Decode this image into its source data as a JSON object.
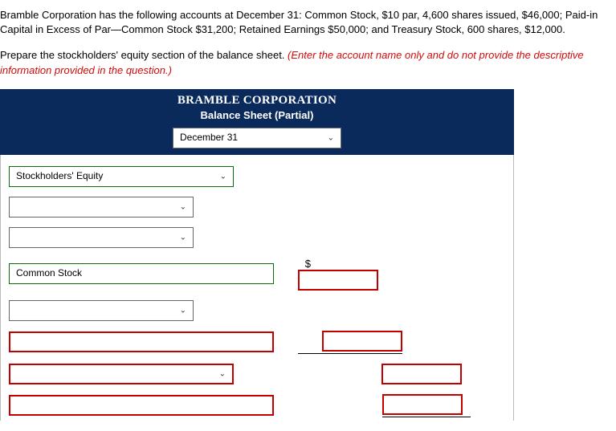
{
  "problem_text": "Bramble Corporation has the following accounts at December 31: Common Stock, $10 par, 4,600 shares issued, $46,000; Paid-in Capital in Excess of Par—Common Stock $31,200; Retained Earnings $50,000; and Treasury Stock, 600 shares, $12,000.",
  "instruction_plain": "Prepare the stockholders' equity section of the balance sheet. ",
  "instruction_red": "(Enter the account name only and do not provide the descriptive information provided in the question.)",
  "header": {
    "company": "BRAMBLE CORPORATION",
    "report": "Balance Sheet (Partial)",
    "date": "December 31"
  },
  "rows": {
    "r1_select": "Stockholders' Equity",
    "r2_select": "",
    "r3_select": "",
    "r4_text": "Common Stock",
    "r4_dollar": "$",
    "r4_amount": "",
    "r5_select": "",
    "r6_text": "",
    "r6_amount": "",
    "r7_select": "",
    "r7_amount": "",
    "r8_text": "",
    "r8_amount": ""
  }
}
